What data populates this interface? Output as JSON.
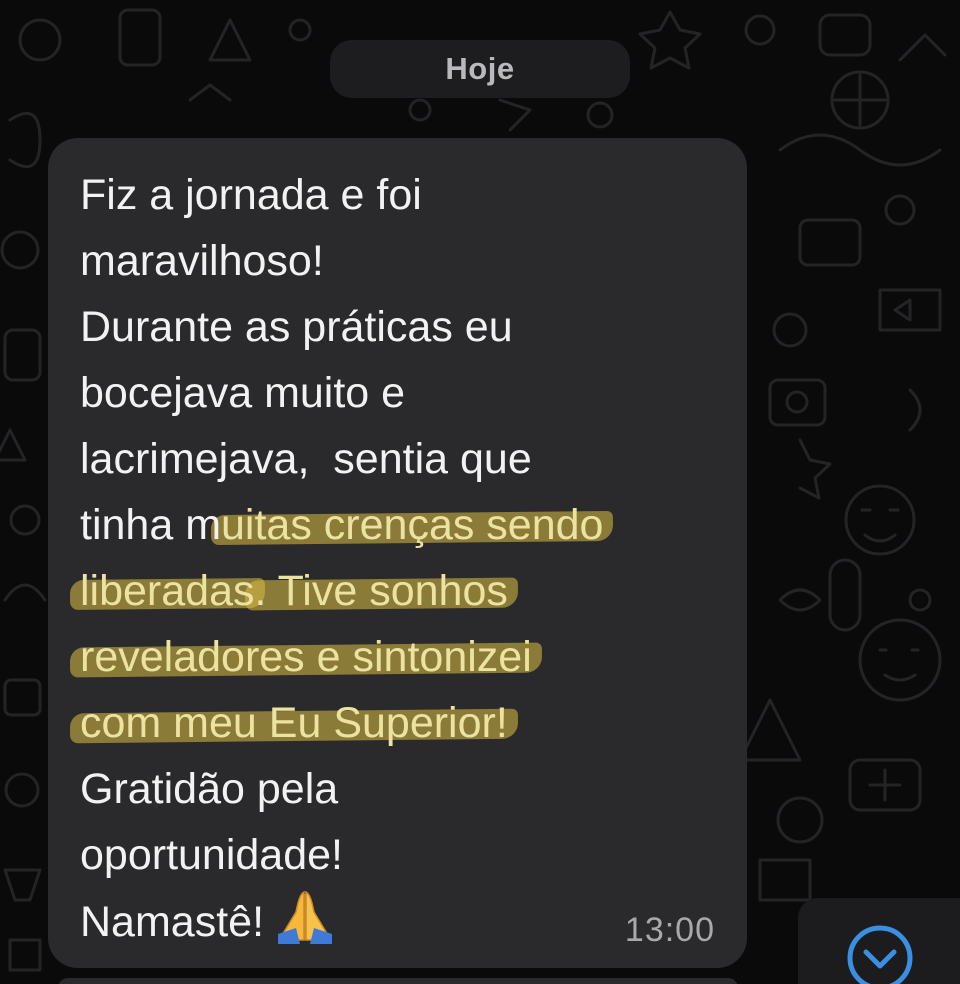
{
  "chat": {
    "date_separator": "Hoje",
    "message": {
      "lines": [
        {
          "text": "Fiz a jornada e foi"
        },
        {
          "text": "maravilhoso!"
        },
        {
          "text": "Durante as práticas eu"
        },
        {
          "text": "bocejava muito e"
        },
        {
          "text": "lacrimejava,  sentia que"
        },
        {
          "pre": "tinha m",
          "highlight": "uitas crenças sendo"
        },
        {
          "highlight": "liberadas",
          "post": ". Tive sonhos",
          "post_highlight": true
        },
        {
          "highlight": "reveladores e sintonizei"
        },
        {
          "highlight": "com meu Eu Superior!"
        },
        {
          "text": "Gratidão pela"
        },
        {
          "text": "oportunidade!"
        },
        {
          "text": "Namastê!",
          "emoji": "folded-hands-icon"
        }
      ],
      "time": "13:00",
      "highlight_color": "#dabe46"
    },
    "scroll_button_icon": "chevron-down-icon",
    "accent_color": "#3b8fe0"
  }
}
